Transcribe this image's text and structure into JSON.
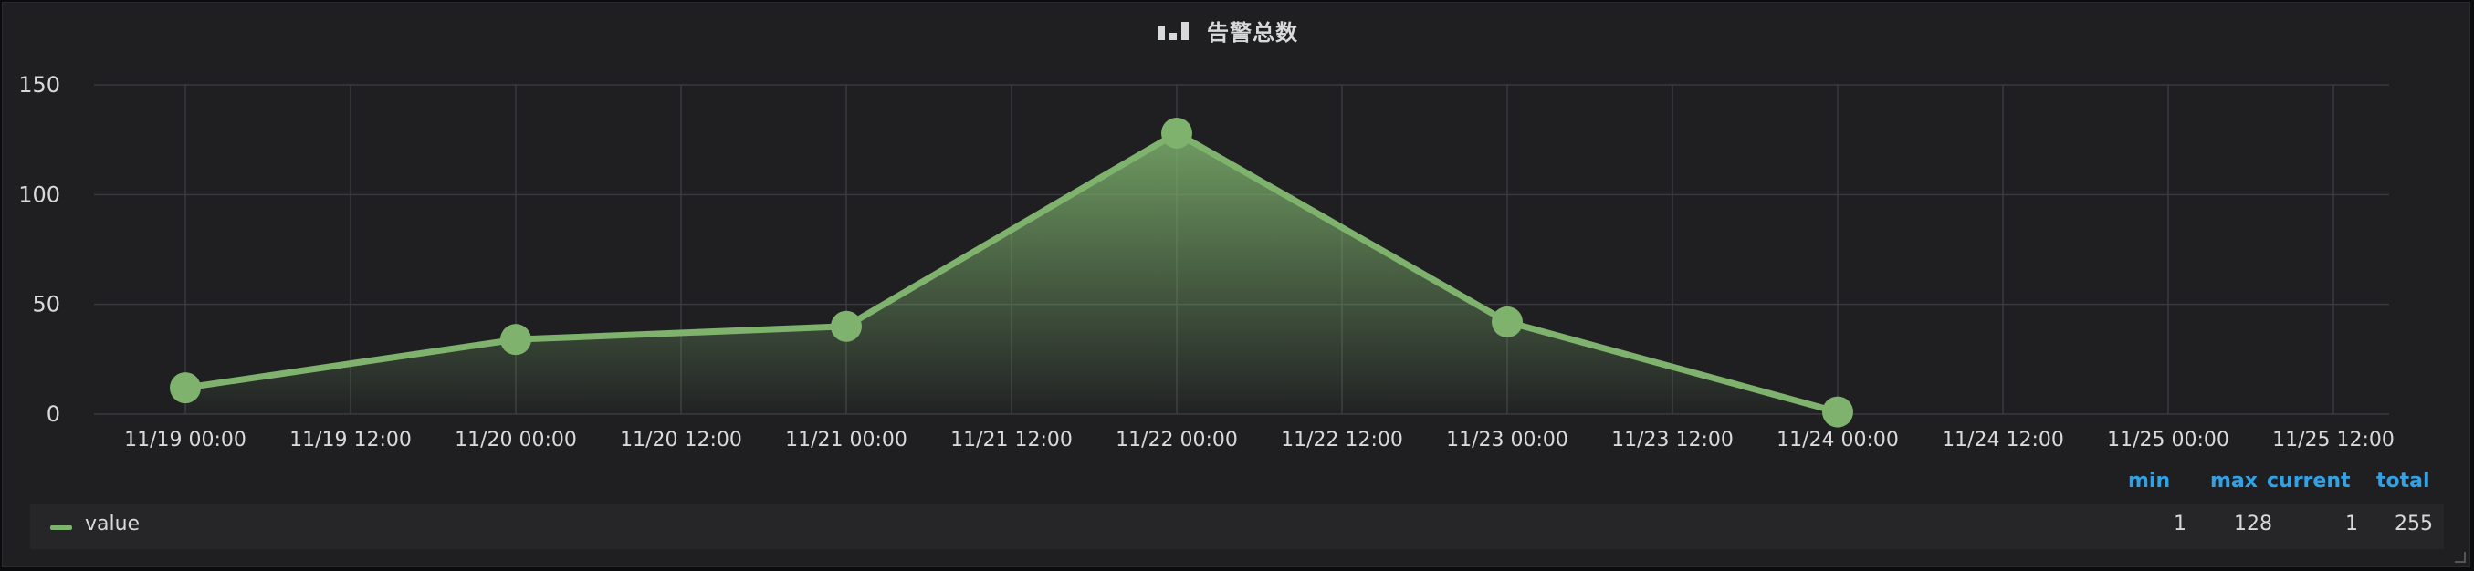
{
  "panel": {
    "title": "告警总数",
    "icon": "bar-chart-icon"
  },
  "colors": {
    "series": "#7eb26d",
    "grid": "#3a3a3e",
    "axis_text": "#d8d9da",
    "legend_header": "#33a2e5",
    "background": "#1f1f22"
  },
  "chart_data": {
    "type": "area",
    "title": "告警总数",
    "xlabel": "",
    "ylabel": "",
    "ylim": [
      0,
      150
    ],
    "y_ticks": [
      "0",
      "50",
      "100",
      "150"
    ],
    "x_ticks": [
      "11/19 00:00",
      "11/19 12:00",
      "11/20 00:00",
      "11/20 12:00",
      "11/21 00:00",
      "11/21 12:00",
      "11/22 00:00",
      "11/22 12:00",
      "11/23 00:00",
      "11/23 12:00",
      "11/24 00:00",
      "11/24 12:00",
      "11/25 00:00",
      "11/25 12:00"
    ],
    "grid": true,
    "series": [
      {
        "name": "value",
        "x": [
          "11/19 00:00",
          "11/20 00:00",
          "11/21 00:00",
          "11/22 00:00",
          "11/23 00:00",
          "11/24 00:00"
        ],
        "values": [
          12,
          34,
          40,
          128,
          42,
          1
        ]
      }
    ]
  },
  "legend": {
    "headers": {
      "min": "min",
      "max": "max",
      "current": "current",
      "total": "total"
    },
    "items": [
      {
        "name": "value",
        "min": "1",
        "max": "128",
        "current": "1",
        "total": "255"
      }
    ]
  }
}
